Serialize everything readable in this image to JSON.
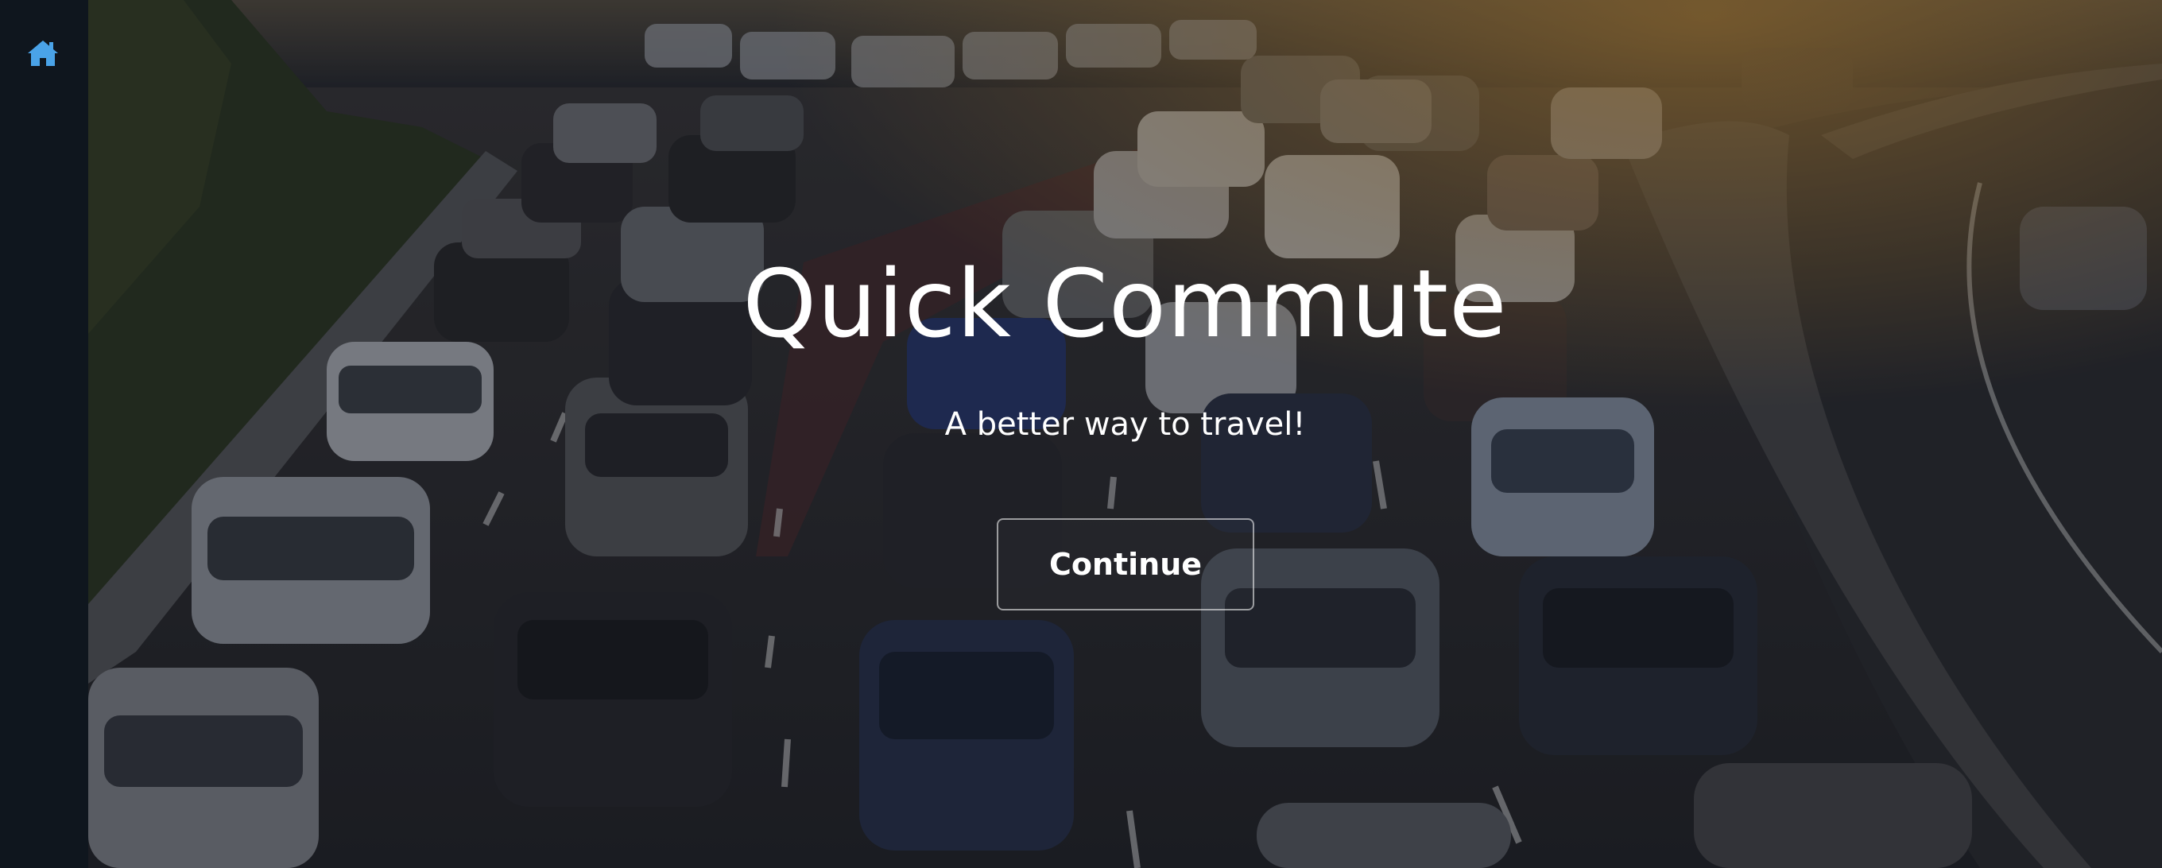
{
  "sidebar": {
    "home_icon": "home-icon",
    "accent_color": "#4aa3e8"
  },
  "hero": {
    "background": "traffic-jam-photo",
    "title": "Quick Commute",
    "subtitle": "A better way to travel!",
    "cta_label": "Continue"
  },
  "colors": {
    "sidebar_bg": "#0f161e",
    "text": "#ffffff"
  }
}
